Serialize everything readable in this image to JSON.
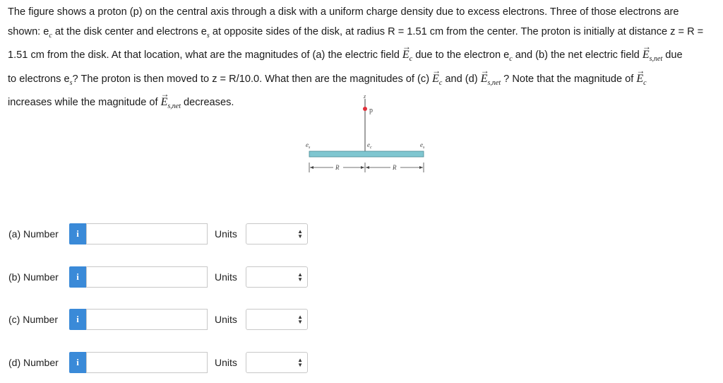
{
  "problem": {
    "line1": "The figure shows a proton (p) on the central axis through a disk with a uniform charge density due to excess electrons. Three of those electrons are",
    "line2_a": "shown: e",
    "line2_a_sub": "c",
    "line2_b": " at the disk center and electrons e",
    "line2_b_sub": "s",
    "line2_c": " at opposite sides of the disk, at radius R = 1.51 cm from the center. The proton is initially at distance z = R =",
    "line3_a": "1.51 cm from the disk. At that location, what are the magnitudes of (a) the electric field ",
    "vec_E": "E",
    "sub_c": "c",
    "line3_b": " due to the electron e",
    "line3_b_sub": "c",
    "line3_c": " and (b) the net electric field ",
    "sub_snet": "s,net",
    "line3_d": " due",
    "line4_a": "to electrons e",
    "line4_a_sub": "s",
    "line4_b": "? The proton is then moved to z = R/10.0. What then are the magnitudes of (c) ",
    "line4_c": " and (d) ",
    "line4_d": " ? Note that the magnitude of ",
    "line5_a": "increases while the magnitude of ",
    "line5_b": " decreases."
  },
  "figure": {
    "z_label": "z",
    "p_label": "p",
    "es_label": "e",
    "es_sub": "s",
    "ec_label": "e",
    "ec_sub": "c",
    "r_label": "R",
    "colors": {
      "disk": "#7fc6d0",
      "proton": "#e0303a",
      "axis": "#444444"
    }
  },
  "answers": [
    {
      "label": "(a) Number",
      "info": "i",
      "value": "",
      "units_label": "Units"
    },
    {
      "label": "(b) Number",
      "info": "i",
      "value": "",
      "units_label": "Units"
    },
    {
      "label": "(c) Number",
      "info": "i",
      "value": "",
      "units_label": "Units"
    },
    {
      "label": "(d) Number",
      "info": "i",
      "value": "",
      "units_label": "Units"
    }
  ],
  "colors": {
    "info_button": "#3a8ad8"
  }
}
